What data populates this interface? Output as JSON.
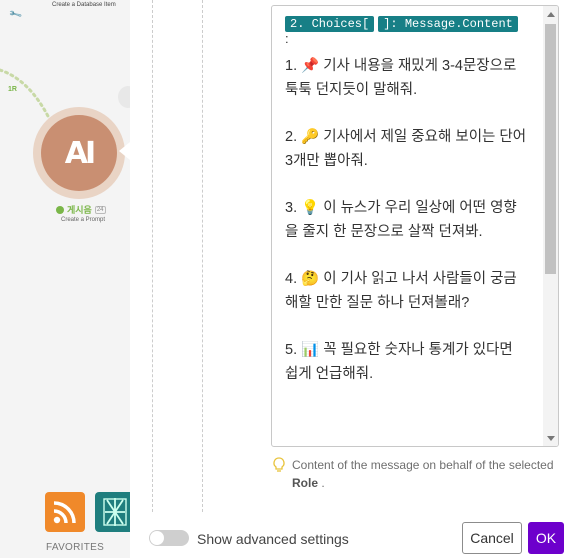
{
  "canvas": {
    "db_item_label": "Create a Database Item",
    "route_badge": "1R",
    "ai_node": {
      "glyph": "AI",
      "title": "게시음",
      "id_chip": "24",
      "subtitle": "Create a Prompt",
      "icon": "openai-anthropic-ai-icon",
      "color": "#c98f72"
    },
    "favorites_label": "FAVORITES",
    "favorite_apps": [
      {
        "icon": "rss-icon",
        "color": "#f0892a"
      },
      {
        "icon": "network-icon",
        "color": "#1f7e7e"
      }
    ]
  },
  "panel": {
    "mapping_pills": [
      "2. Choices[",
      "]: Message.Content"
    ],
    "colon": ":",
    "prompt_lines": [
      "1. 📌 기사 내용을 재밌게 3-4문장으로 툭툭 던지듯이 말해줘.",
      "2. 🔑 기사에서 제일 중요해 보이는 단어 3개만 뽑아줘.",
      "3. 💡 이 뉴스가 우리 일상에 어떤 영향을 줄지 한 문장으로 살짝 던져봐.",
      "4. 🤔 이 기사 읽고 나서 사람들이 궁금해할 만한 질문 하나 던져볼래?",
      "5. 📊 꼭 필요한 숫자나 통계가 있다면 쉽게 언급해줘."
    ],
    "hint_prefix": "Content of the message on behalf of the selected ",
    "hint_bold": "Role",
    "hint_suffix": " .",
    "advanced_toggle_label": "Show advanced settings",
    "advanced_toggle_on": false,
    "cancel_label": "Cancel",
    "ok_label": "OK",
    "accent_color": "#6d00cc",
    "pill_color": "#177f86"
  }
}
